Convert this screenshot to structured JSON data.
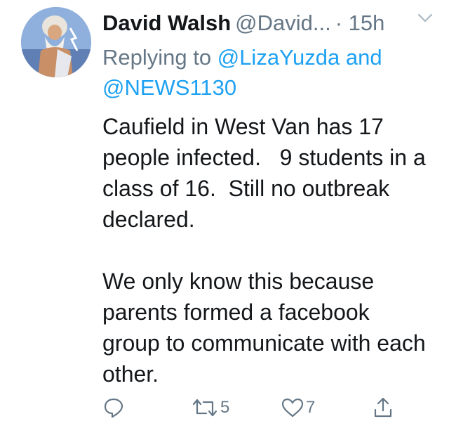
{
  "author": {
    "name": "David Walsh",
    "handle": "@David...",
    "time": "· 15h"
  },
  "reply": {
    "prefix": "Replying to",
    "mention1": "@LizaYuzda",
    "joiner": "and",
    "mention2": "@NEWS1130"
  },
  "body": {
    "paragraph1": "Caufield in West Van has 17 people infected.   9 students in a class of 16.  Still no outbreak declared.",
    "paragraph2": "We only know this because parents formed a facebook group to communicate with each other."
  },
  "actions": {
    "reply_icon": "reply-icon",
    "retweet_icon": "retweet-icon",
    "retweet_count": "5",
    "like_icon": "heart-icon",
    "like_count": "7",
    "share_icon": "share-icon"
  },
  "colors": {
    "link": "#1da1f2",
    "secondary": "#657786",
    "text": "#14171a"
  }
}
